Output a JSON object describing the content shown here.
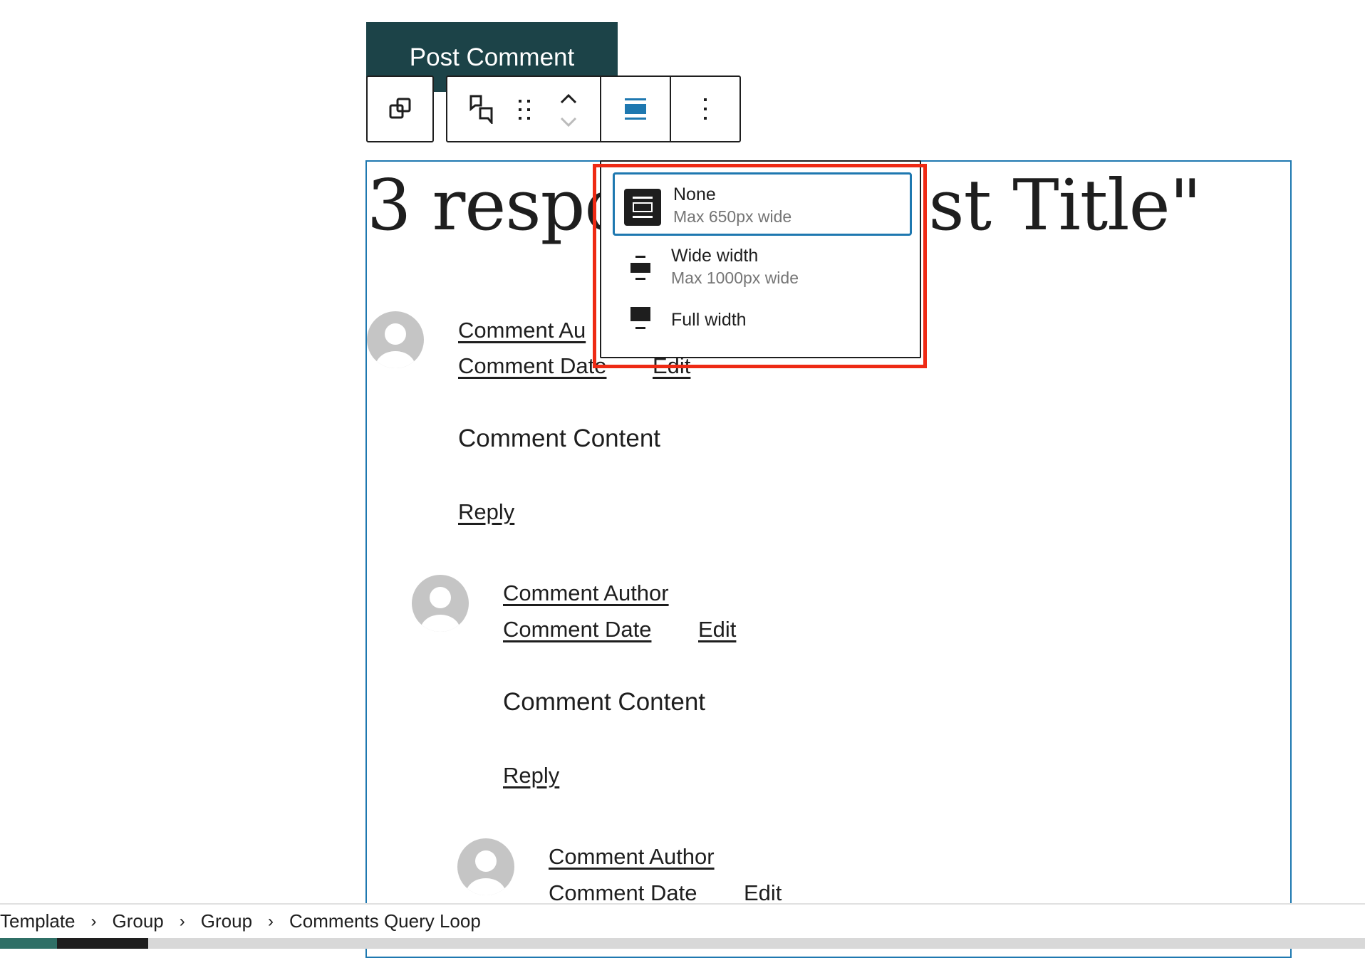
{
  "post_comment_button": "Post Comment",
  "toolbar": {
    "parent_icon": "copy-stack-icon",
    "block_icon": "comments-icon",
    "drag_icon": "drag-handle-icon",
    "move_up_icon": "chevron-up-icon",
    "move_down_icon": "chevron-down-icon",
    "align_icon": "align-none-icon",
    "more_icon": "more-vertical-icon",
    "accent_color": "#1e78b0"
  },
  "heading": "3 responses to \"Post Title\"",
  "heading_visible_left": "3 respo",
  "heading_visible_right": "st Title\"",
  "alignment_menu": {
    "items": [
      {
        "title": "None",
        "subtitle": "Max 650px wide",
        "icon": "align-none-icon",
        "selected": true
      },
      {
        "title": "Wide width",
        "subtitle": "Max 1000px wide",
        "icon": "align-wide-icon",
        "selected": false
      },
      {
        "title": "Full width",
        "subtitle": "",
        "icon": "align-full-icon",
        "selected": false
      }
    ],
    "highlight_color": "#ee2a14"
  },
  "comments": [
    {
      "author": "Comment Author",
      "author_visible": "Comment Au",
      "date": "Comment Date",
      "edit": "Edit",
      "content": "Comment Content",
      "reply": "Reply"
    },
    {
      "author": "Comment Author",
      "date": "Comment Date",
      "edit": "Edit",
      "content": "Comment Content",
      "reply": "Reply"
    },
    {
      "author": "Comment Author",
      "date": "Comment Date",
      "edit": "Edit"
    }
  ],
  "breadcrumb": [
    "Template",
    "Group",
    "Group",
    "Comments Query Loop"
  ]
}
